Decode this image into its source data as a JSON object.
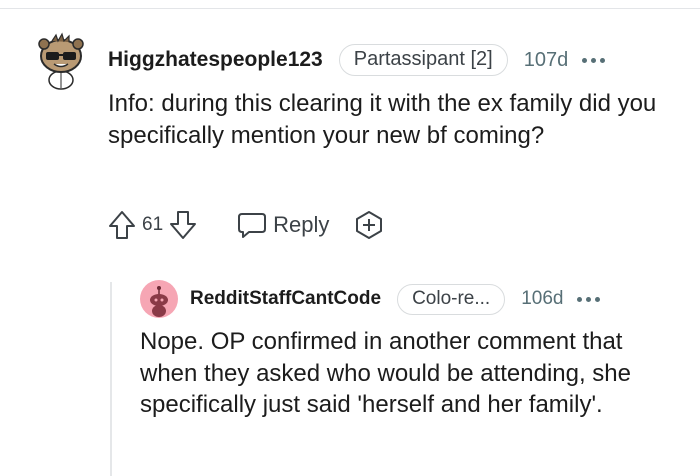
{
  "comment": {
    "author": "Higgzhatespeople123",
    "flair": "Partassipant [2]",
    "age": "107d",
    "body": "Info: during this clearing it with the ex family did you specifically mention your new bf coming?",
    "score": "61",
    "reply_label": "Reply",
    "icons": {
      "avatar": "snoo-avatar-sunglasses",
      "more": "more-options-icon",
      "upvote": "upvote-arrow-icon",
      "downvote": "downvote-arrow-icon",
      "reply": "speech-bubble-icon",
      "award": "plus-award-icon"
    }
  },
  "reply": {
    "author": "RedditStaffCantCode",
    "flair": "Colo-re...",
    "age": "106d",
    "body": "Nope. OP confirmed in another comment that when they asked who would be attending, she specifically just said 'herself and her family'.",
    "icons": {
      "avatar": "default-snoo-avatar",
      "more": "more-options-icon"
    }
  },
  "colors": {
    "text": "#1c1c1c",
    "secondary_text": "#576f76",
    "flair_border": "#d9dcde",
    "reply_avatar_bg": "#f6a6b4",
    "thread_line": "#e5e7e9"
  }
}
